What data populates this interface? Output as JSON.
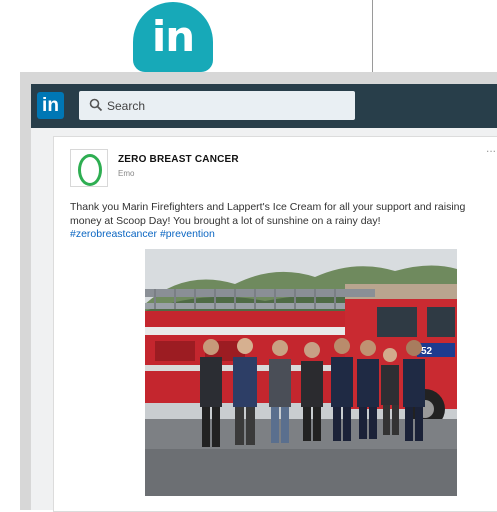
{
  "header_badge": {
    "text": "in"
  },
  "topbar": {
    "logo": "in",
    "search": {
      "placeholder": "Search"
    }
  },
  "post": {
    "company": "ZERO BREAST CANCER",
    "subtitle": "Emo",
    "more": "...",
    "body": "Thank you Marin Firefighters and Lappert's Ice Cream for all your support and raising money at Scoop Day! You brought a lot of sunshine on a rainy day!",
    "hashtags": [
      "#zerobreastcancer",
      "#prevention"
    ],
    "image": {
      "subject": "group-photo-firetruck",
      "truck_number": "52"
    }
  },
  "colors": {
    "badge": "#17a9b8",
    "topbar": "#283e4a",
    "linkedin_blue": "#0077b5",
    "link": "#0b66c2",
    "brand_green": "#2eae52"
  }
}
